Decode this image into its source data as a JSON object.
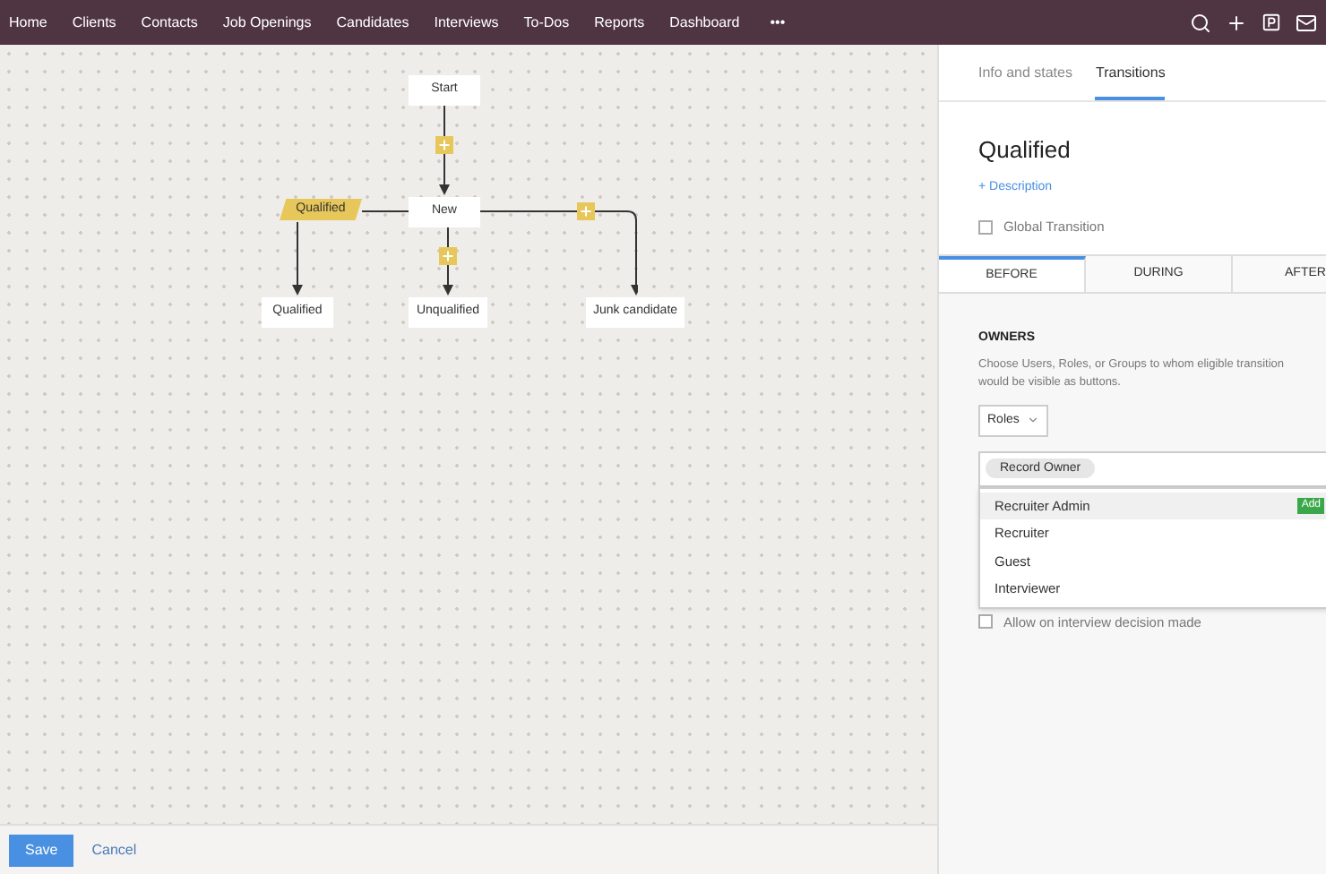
{
  "nav": {
    "items": [
      "Home",
      "Clients",
      "Contacts",
      "Job Openings",
      "Candidates",
      "Interviews",
      "To-Dos",
      "Reports",
      "Dashboard"
    ],
    "more": "•••"
  },
  "diagram": {
    "states": [
      "Start",
      "New",
      "Qualified",
      "Unqualified",
      "Junk candidate"
    ],
    "transition": "Qualified"
  },
  "panel": {
    "tabs": [
      {
        "label": "Info and states",
        "selected": false
      },
      {
        "label": "Transitions",
        "selected": true
      }
    ],
    "title": "Qualified",
    "description_link": "+ Description",
    "global_transition": {
      "label": "Global Transition",
      "checked": false
    },
    "phase_tabs": [
      {
        "label": "BEFORE",
        "selected": true
      },
      {
        "label": "DURING",
        "selected": false
      },
      {
        "label": "AFTER",
        "selected": false
      }
    ],
    "owners": {
      "heading": "OWNERS",
      "hint": "Choose Users, Roles, or Groups to whom eligible transition would be visible as buttons.",
      "type_select": "Roles",
      "chips": [
        "Record Owner"
      ],
      "options": [
        {
          "label": "Recruiter Admin",
          "selected": true,
          "badge": "Add"
        },
        {
          "label": "Recruiter",
          "selected": false
        },
        {
          "label": "Guest",
          "selected": false
        },
        {
          "label": "Interviewer",
          "selected": false
        }
      ]
    },
    "interview_option": {
      "label": "Allow on interview decision made",
      "checked": false
    }
  },
  "footer": {
    "save": "Save",
    "cancel": "Cancel"
  }
}
